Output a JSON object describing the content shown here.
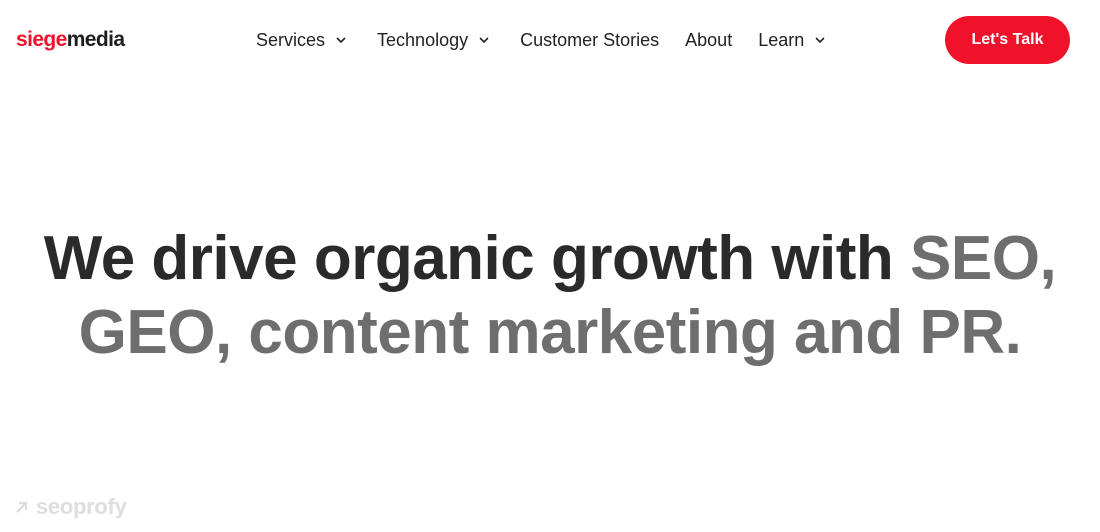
{
  "brand": {
    "logo_part1": "siege",
    "logo_part2": "media",
    "accent": "#f0112b"
  },
  "nav": {
    "services": "Services",
    "technology": "Technology",
    "customer_stories": "Customer Stories",
    "about": "About",
    "learn": "Learn"
  },
  "cta": {
    "label": "Let's Talk"
  },
  "hero": {
    "dark_text": "We drive organic growth with ",
    "gray_text": "SEO, GEO, content marketing and PR."
  },
  "watermark": {
    "label": "seoprofy"
  }
}
